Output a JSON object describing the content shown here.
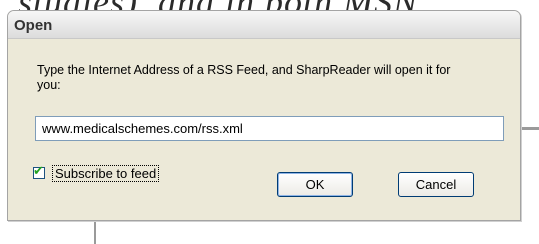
{
  "background": {
    "partial_text": "studies), and in both MSN"
  },
  "dialog": {
    "title": "Open",
    "message": "Type the Internet Address of a RSS Feed, and SharpReader will open it for you:",
    "url_value": "www.medicalschemes.com/rss.xml",
    "subscribe_label": "Subscribe to feed",
    "subscribe_checked": true,
    "ok_label": "OK",
    "cancel_label": "Cancel"
  },
  "colors": {
    "dialog_background": "#ece9d8",
    "button_border": "#003c74",
    "input_border": "#7f9db9"
  },
  "icons": {
    "checkmark": "check-icon"
  }
}
